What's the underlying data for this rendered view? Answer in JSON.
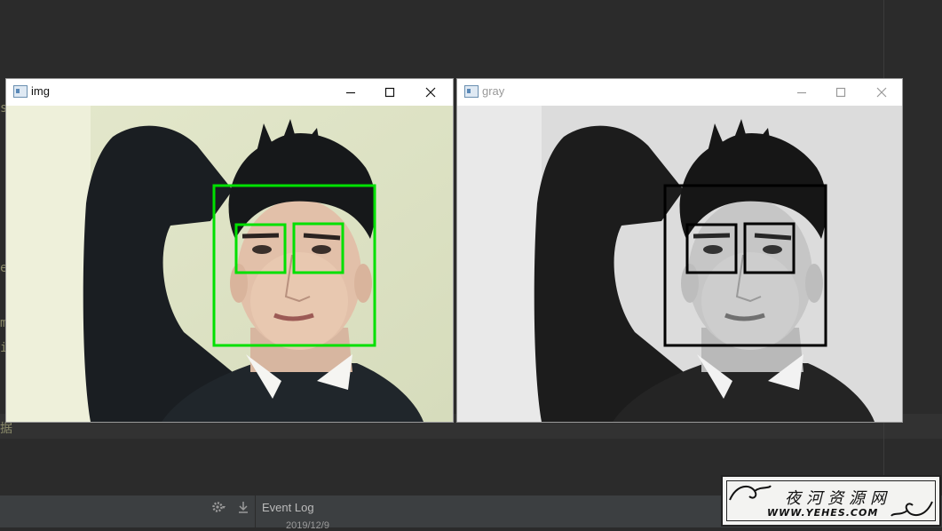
{
  "ide": {
    "edge_chars": [
      "s",
      "e",
      "m",
      "i",
      "据"
    ],
    "event_log_label": "Event Log",
    "event_date": "2019/12/9"
  },
  "windows": {
    "img": {
      "title": "img"
    },
    "gray": {
      "title": "gray"
    }
  },
  "watermark": {
    "name": "夜河资源网",
    "url": "WWW.YEHES.COM"
  },
  "colors": {
    "detect_color_img": "#00e000",
    "detect_color_gray": "#000000",
    "ide_bg": "#2b2b2b"
  }
}
